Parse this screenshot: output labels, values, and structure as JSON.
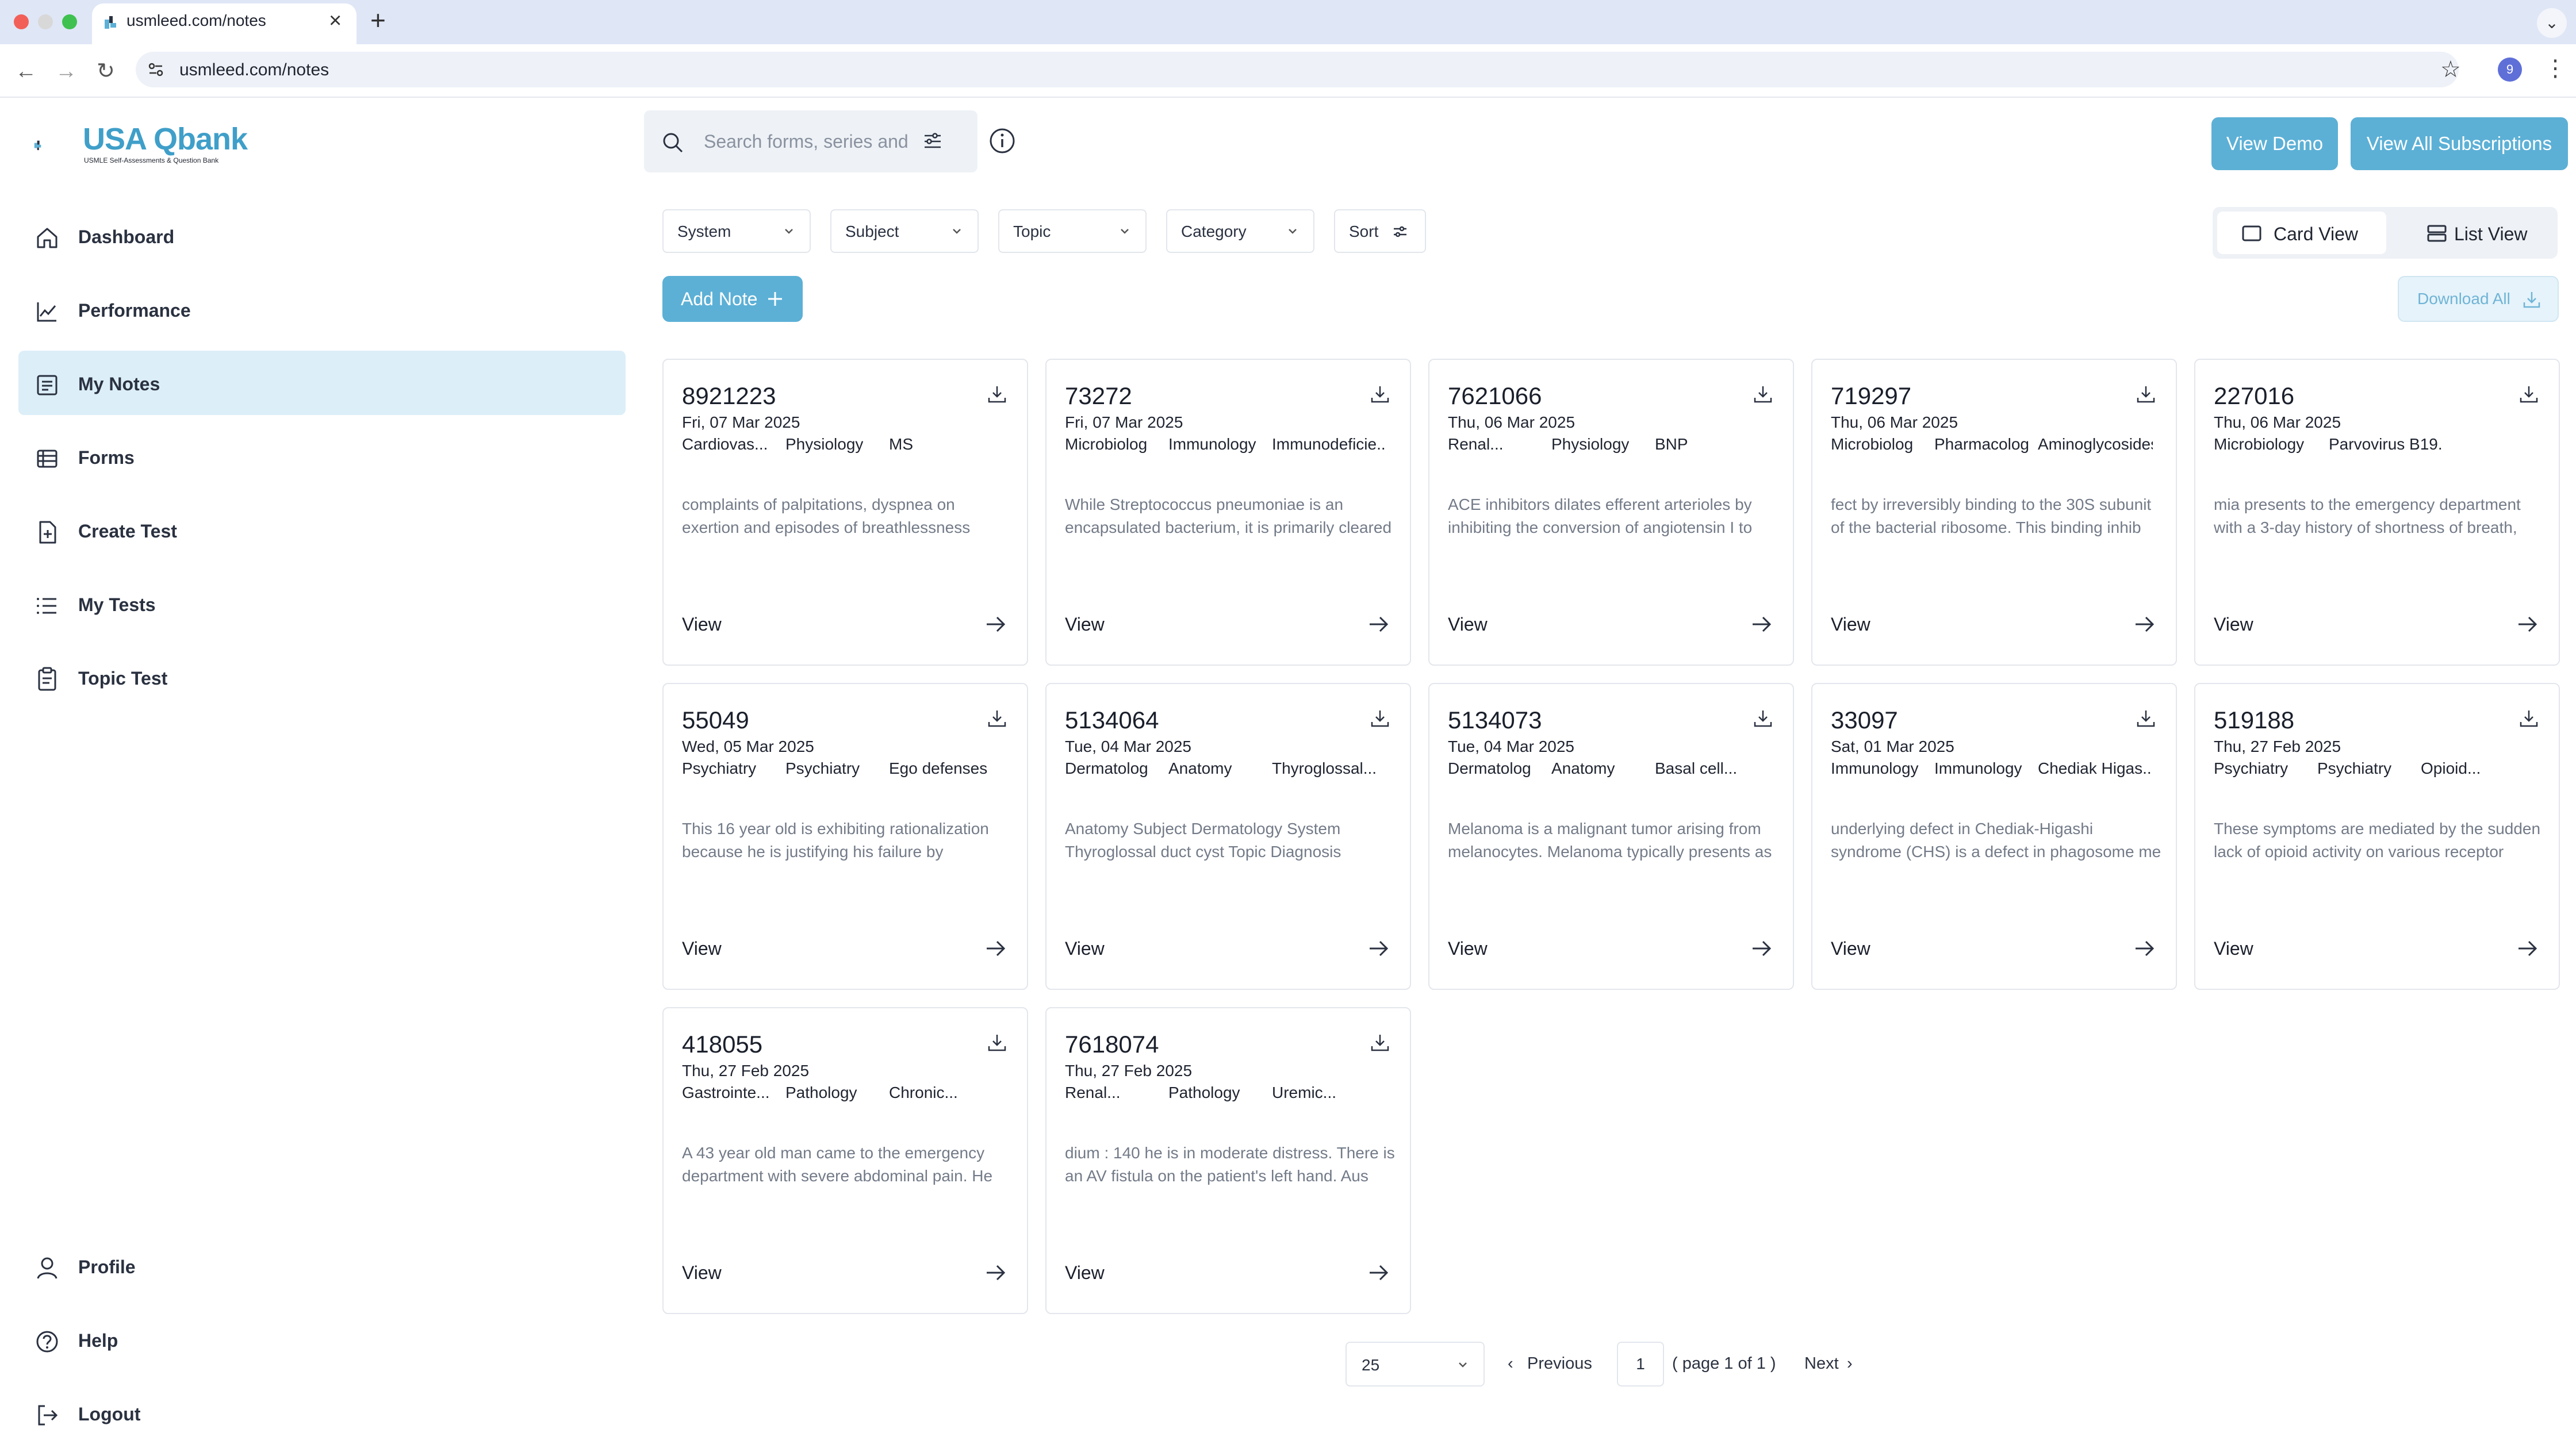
{
  "browser": {
    "tab_title": "usmleed.com/notes",
    "url": "usmleed.com/notes",
    "profile_initial": "9"
  },
  "brand": {
    "logo_text": "USA Qbank",
    "logo_subtext": "USMLE Self-Assessments & Question Bank",
    "accent_color": "#5cb0d6"
  },
  "sidebar": {
    "items": [
      {
        "label": "Dashboard",
        "icon": "home-icon"
      },
      {
        "label": "Performance",
        "icon": "chart-icon"
      },
      {
        "label": "My Notes",
        "icon": "notes-icon",
        "active": true
      },
      {
        "label": "Forms",
        "icon": "table-icon"
      },
      {
        "label": "Create Test",
        "icon": "file-plus-icon"
      },
      {
        "label": "My Tests",
        "icon": "list-icon"
      },
      {
        "label": "Topic Test",
        "icon": "clipboard-icon"
      }
    ],
    "bottom": [
      {
        "label": "Profile",
        "icon": "user-icon"
      },
      {
        "label": "Help",
        "icon": "help-icon"
      },
      {
        "label": "Logout",
        "icon": "logout-icon"
      }
    ]
  },
  "topbar": {
    "search_placeholder": "Search forms, series and",
    "view_demo": "View Demo",
    "view_all_subscriptions": "View All Subscriptions"
  },
  "filters": {
    "system": "System",
    "subject": "Subject",
    "topic": "Topic",
    "category": "Category",
    "sort": "Sort"
  },
  "view_toggle": {
    "card_view": "Card View",
    "list_view": "List View",
    "selected": "Card View"
  },
  "actions": {
    "add_note": "Add Note",
    "download_all": "Download All"
  },
  "notes": [
    {
      "id": "8921223",
      "date": "Fri, 07 Mar 2025",
      "tags": [
        "Cardiovas...",
        "Physiology",
        "MS"
      ],
      "text": "complaints of palpitations, dyspnea on exertion and episodes of breathlessness",
      "view": "View"
    },
    {
      "id": "73272",
      "date": "Fri, 07 Mar 2025",
      "tags": [
        "Microbiolog",
        "Immunology",
        "Immunodeficie..."
      ],
      "text": "While Streptococcus pneumoniae is an encapsulated bacterium, it is primarily cleared",
      "view": "View"
    },
    {
      "id": "7621066",
      "date": "Thu, 06 Mar 2025",
      "tags": [
        "Renal...",
        "Physiology",
        "BNP"
      ],
      "text": "ACE inhibitors dilates efferent arterioles by inhibiting the conversion of angiotensin I to",
      "view": "View"
    },
    {
      "id": "719297",
      "date": "Thu, 06 Mar 2025",
      "tags": [
        "Microbiolog",
        "Pharmacolog",
        "Aminoglycosides"
      ],
      "text": "fect by irreversibly binding to the 30S subunit of the bacterial ribosome. This binding inhib",
      "view": "View"
    },
    {
      "id": "227016",
      "date": "Thu, 06 Mar 2025",
      "tags": [
        "Microbiology",
        "Parvovirus B19..."
      ],
      "text": "mia presents to the emergency department with a 3-day history of shortness of breath,",
      "view": "View"
    },
    {
      "id": "55049",
      "date": "Wed, 05 Mar 2025",
      "tags": [
        "Psychiatry",
        "Psychiatry",
        "Ego defenses"
      ],
      "text": "This 16 year old is exhibiting rationalization because he is justifying his failure by",
      "view": "View"
    },
    {
      "id": "5134064",
      "date": "Tue, 04 Mar 2025",
      "tags": [
        "Dermatolog",
        "Anatomy",
        "Thyroglossal..."
      ],
      "text": "Anatomy Subject Dermatology System Thyroglossal duct cyst Topic Diagnosis",
      "view": "View"
    },
    {
      "id": "5134073",
      "date": "Tue, 04 Mar 2025",
      "tags": [
        "Dermatolog",
        "Anatomy",
        "Basal cell..."
      ],
      "text": "Melanoma is a malignant tumor arising from melanocytes. Melanoma typically presents as",
      "view": "View"
    },
    {
      "id": "33097",
      "date": "Sat, 01 Mar 2025",
      "tags": [
        "Immunology",
        "Immunology",
        "Chediak Higas..."
      ],
      "text": "underlying defect in Chediak-Higashi syndrome (CHS) is a defect in phagosome me",
      "view": "View"
    },
    {
      "id": "519188",
      "date": "Thu, 27 Feb 2025",
      "tags": [
        "Psychiatry",
        "Psychiatry",
        "Opioid..."
      ],
      "text": "These symptoms are mediated by the sudden lack of opioid activity on various receptor",
      "view": "View"
    },
    {
      "id": "418055",
      "date": "Thu, 27 Feb 2025",
      "tags": [
        "Gastrointe...",
        "Pathology",
        "Chronic..."
      ],
      "text": "A 43 year old man came to the emergency department with severe abdominal pain. He",
      "view": "View"
    },
    {
      "id": "7618074",
      "date": "Thu, 27 Feb 2025",
      "tags": [
        "Renal...",
        "Pathology",
        "Uremic..."
      ],
      "text": "dium : 140 he is in moderate distress. There is an AV fistula on the patient's left hand. Aus",
      "view": "View"
    }
  ],
  "pagination": {
    "page_size": "25",
    "previous": "Previous",
    "current_page": "1",
    "page_info": "( page 1 of 1 )",
    "next": "Next"
  }
}
